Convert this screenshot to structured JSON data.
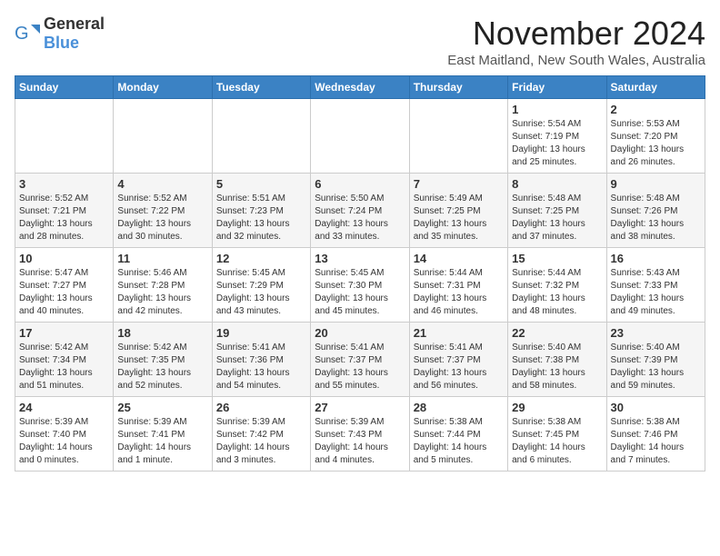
{
  "header": {
    "logo_general": "General",
    "logo_blue": "Blue",
    "month_title": "November 2024",
    "location": "East Maitland, New South Wales, Australia"
  },
  "days_of_week": [
    "Sunday",
    "Monday",
    "Tuesday",
    "Wednesday",
    "Thursday",
    "Friday",
    "Saturday"
  ],
  "weeks": [
    [
      {
        "day": "",
        "info": ""
      },
      {
        "day": "",
        "info": ""
      },
      {
        "day": "",
        "info": ""
      },
      {
        "day": "",
        "info": ""
      },
      {
        "day": "",
        "info": ""
      },
      {
        "day": "1",
        "info": "Sunrise: 5:54 AM\nSunset: 7:19 PM\nDaylight: 13 hours and 25 minutes."
      },
      {
        "day": "2",
        "info": "Sunrise: 5:53 AM\nSunset: 7:20 PM\nDaylight: 13 hours and 26 minutes."
      }
    ],
    [
      {
        "day": "3",
        "info": "Sunrise: 5:52 AM\nSunset: 7:21 PM\nDaylight: 13 hours and 28 minutes."
      },
      {
        "day": "4",
        "info": "Sunrise: 5:52 AM\nSunset: 7:22 PM\nDaylight: 13 hours and 30 minutes."
      },
      {
        "day": "5",
        "info": "Sunrise: 5:51 AM\nSunset: 7:23 PM\nDaylight: 13 hours and 32 minutes."
      },
      {
        "day": "6",
        "info": "Sunrise: 5:50 AM\nSunset: 7:24 PM\nDaylight: 13 hours and 33 minutes."
      },
      {
        "day": "7",
        "info": "Sunrise: 5:49 AM\nSunset: 7:25 PM\nDaylight: 13 hours and 35 minutes."
      },
      {
        "day": "8",
        "info": "Sunrise: 5:48 AM\nSunset: 7:25 PM\nDaylight: 13 hours and 37 minutes."
      },
      {
        "day": "9",
        "info": "Sunrise: 5:48 AM\nSunset: 7:26 PM\nDaylight: 13 hours and 38 minutes."
      }
    ],
    [
      {
        "day": "10",
        "info": "Sunrise: 5:47 AM\nSunset: 7:27 PM\nDaylight: 13 hours and 40 minutes."
      },
      {
        "day": "11",
        "info": "Sunrise: 5:46 AM\nSunset: 7:28 PM\nDaylight: 13 hours and 42 minutes."
      },
      {
        "day": "12",
        "info": "Sunrise: 5:45 AM\nSunset: 7:29 PM\nDaylight: 13 hours and 43 minutes."
      },
      {
        "day": "13",
        "info": "Sunrise: 5:45 AM\nSunset: 7:30 PM\nDaylight: 13 hours and 45 minutes."
      },
      {
        "day": "14",
        "info": "Sunrise: 5:44 AM\nSunset: 7:31 PM\nDaylight: 13 hours and 46 minutes."
      },
      {
        "day": "15",
        "info": "Sunrise: 5:44 AM\nSunset: 7:32 PM\nDaylight: 13 hours and 48 minutes."
      },
      {
        "day": "16",
        "info": "Sunrise: 5:43 AM\nSunset: 7:33 PM\nDaylight: 13 hours and 49 minutes."
      }
    ],
    [
      {
        "day": "17",
        "info": "Sunrise: 5:42 AM\nSunset: 7:34 PM\nDaylight: 13 hours and 51 minutes."
      },
      {
        "day": "18",
        "info": "Sunrise: 5:42 AM\nSunset: 7:35 PM\nDaylight: 13 hours and 52 minutes."
      },
      {
        "day": "19",
        "info": "Sunrise: 5:41 AM\nSunset: 7:36 PM\nDaylight: 13 hours and 54 minutes."
      },
      {
        "day": "20",
        "info": "Sunrise: 5:41 AM\nSunset: 7:37 PM\nDaylight: 13 hours and 55 minutes."
      },
      {
        "day": "21",
        "info": "Sunrise: 5:41 AM\nSunset: 7:37 PM\nDaylight: 13 hours and 56 minutes."
      },
      {
        "day": "22",
        "info": "Sunrise: 5:40 AM\nSunset: 7:38 PM\nDaylight: 13 hours and 58 minutes."
      },
      {
        "day": "23",
        "info": "Sunrise: 5:40 AM\nSunset: 7:39 PM\nDaylight: 13 hours and 59 minutes."
      }
    ],
    [
      {
        "day": "24",
        "info": "Sunrise: 5:39 AM\nSunset: 7:40 PM\nDaylight: 14 hours and 0 minutes."
      },
      {
        "day": "25",
        "info": "Sunrise: 5:39 AM\nSunset: 7:41 PM\nDaylight: 14 hours and 1 minute."
      },
      {
        "day": "26",
        "info": "Sunrise: 5:39 AM\nSunset: 7:42 PM\nDaylight: 14 hours and 3 minutes."
      },
      {
        "day": "27",
        "info": "Sunrise: 5:39 AM\nSunset: 7:43 PM\nDaylight: 14 hours and 4 minutes."
      },
      {
        "day": "28",
        "info": "Sunrise: 5:38 AM\nSunset: 7:44 PM\nDaylight: 14 hours and 5 minutes."
      },
      {
        "day": "29",
        "info": "Sunrise: 5:38 AM\nSunset: 7:45 PM\nDaylight: 14 hours and 6 minutes."
      },
      {
        "day": "30",
        "info": "Sunrise: 5:38 AM\nSunset: 7:46 PM\nDaylight: 14 hours and 7 minutes."
      }
    ]
  ]
}
